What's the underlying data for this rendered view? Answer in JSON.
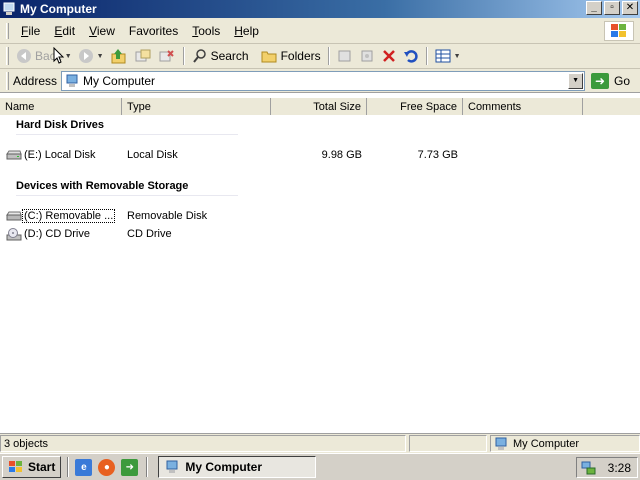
{
  "window": {
    "title": "My Computer"
  },
  "title_buttons": [
    "_",
    "▫",
    "✕"
  ],
  "menu": [
    {
      "label": "File",
      "accel": "F",
      "rest": "ile"
    },
    {
      "label": "Edit",
      "accel": "E",
      "rest": "dit"
    },
    {
      "label": "View",
      "accel": "V",
      "rest": "iew"
    },
    {
      "label": "Favorites",
      "accel": "",
      "rest": "Favorites"
    },
    {
      "label": "Tools",
      "accel": "T",
      "rest": "ools"
    },
    {
      "label": "Help",
      "accel": "H",
      "rest": "elp"
    }
  ],
  "toolbar": {
    "back_label": "Back",
    "search_label": "Search",
    "folders_label": "Folders"
  },
  "address": {
    "label": "Address",
    "value": "My Computer",
    "go_label": "Go"
  },
  "columns": {
    "name": "Name",
    "type": "Type",
    "total_size": "Total Size",
    "free_space": "Free Space",
    "comments": "Comments"
  },
  "groups": [
    {
      "title": "Hard Disk Drives",
      "items": [
        {
          "name": "(E:) Local Disk",
          "type": "Local Disk",
          "total": "9.98 GB",
          "free": "7.73 GB",
          "icon": "hard-drive-icon"
        }
      ]
    },
    {
      "title": "Devices with Removable Storage",
      "items": [
        {
          "name": "(C:) Removable ...",
          "type": "Removable Disk",
          "total": "",
          "free": "",
          "icon": "removable-drive-icon"
        },
        {
          "name": "(D:) CD Drive",
          "type": "CD Drive",
          "total": "",
          "free": "",
          "icon": "cd-drive-icon"
        }
      ]
    }
  ],
  "status": {
    "objects": "3 objects",
    "location": "My Computer"
  },
  "taskbar": {
    "start_label": "Start",
    "task_label": "My Computer",
    "clock": "3:28"
  }
}
